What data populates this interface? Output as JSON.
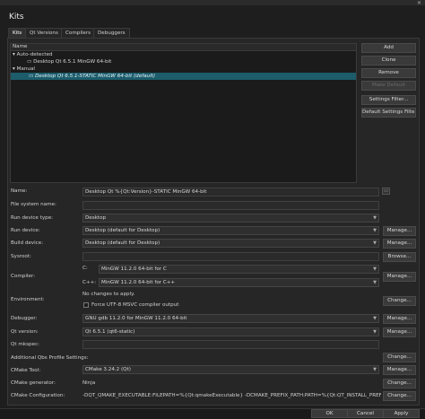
{
  "window": {
    "title": "Kits",
    "close_glyph": "✕"
  },
  "tabs": [
    "Kits",
    "Qt Versions",
    "Compilers",
    "Debuggers"
  ],
  "tree": {
    "header": "Name",
    "groups": [
      {
        "label": "Auto-detected",
        "items": [
          "Desktop Qt 6.5.1 MinGW 64-bit"
        ]
      },
      {
        "label": "Manual",
        "items": [
          "Desktop Qt 6.5.1-STATIC MinGW 64-bit (default)"
        ]
      }
    ],
    "expand_glyph": "▾"
  },
  "side_buttons": {
    "add": "Add",
    "clone": "Clone",
    "remove": "Remove",
    "make_default": "Make Default",
    "settings_filter": "Settings Filter...",
    "default_settings_filter": "Default Settings Filter..."
  },
  "form": {
    "name": {
      "label": "Name:",
      "value": "Desktop Qt %{Qt:Version}-STATIC MinGW 64-bit"
    },
    "file_system_name": {
      "label": "File system name:",
      "value": ""
    },
    "run_device_type": {
      "label": "Run device type:",
      "value": "Desktop"
    },
    "run_device": {
      "label": "Run device:",
      "value": "Desktop (default for Desktop)"
    },
    "build_device": {
      "label": "Build device:",
      "value": "Desktop (default for Desktop)"
    },
    "sysroot": {
      "label": "Sysroot:",
      "value": ""
    },
    "compiler": {
      "label": "Compiler:",
      "c_label": "C:",
      "c_value": "MinGW 11.2.0 64-bit for C",
      "cpp_label": "C++:",
      "cpp_value": "MinGW 11.2.0 64-bit for C++"
    },
    "environment": {
      "label": "Environment:",
      "value": "No changes to apply.",
      "checkbox_label": "Force UTF-8 MSVC compiler output"
    },
    "debugger": {
      "label": "Debugger:",
      "value": "GNU gdb 11.2.0 for MinGW 11.2.0 64-bit"
    },
    "qt_version": {
      "label": "Qt version:",
      "value": "Qt 6.5.1 (qt6-static)"
    },
    "qt_mkspec": {
      "label": "Qt mkspec:",
      "value": ""
    },
    "qbs": {
      "label": "Additional Qbs Profile Settings:"
    },
    "cmake_tool": {
      "label": "CMake Tool:",
      "value": "CMake 3.24.2 (Qt)"
    },
    "cmake_generator": {
      "label": "CMake generator:",
      "value": "Ninja"
    },
    "cmake_configuration": {
      "label": "CMake Configuration:",
      "value": "-DQT_QMAKE_EXECUTABLE:FILEPATH=%{Qt:qmakeExecutable} -DCMAKE_PREFIX_PATH:PATH=%{Qt:QT_INSTALL_PREFIX} -DCM..."
    }
  },
  "buttons": {
    "manage": "Manage...",
    "browse": "Browse...",
    "change": "Change..."
  },
  "dialog_buttons": {
    "ok": "OK",
    "cancel": "Cancel",
    "apply": "Apply"
  },
  "icons": {
    "monitor": "monitor-icon",
    "picker": "kit-icon-picker"
  }
}
